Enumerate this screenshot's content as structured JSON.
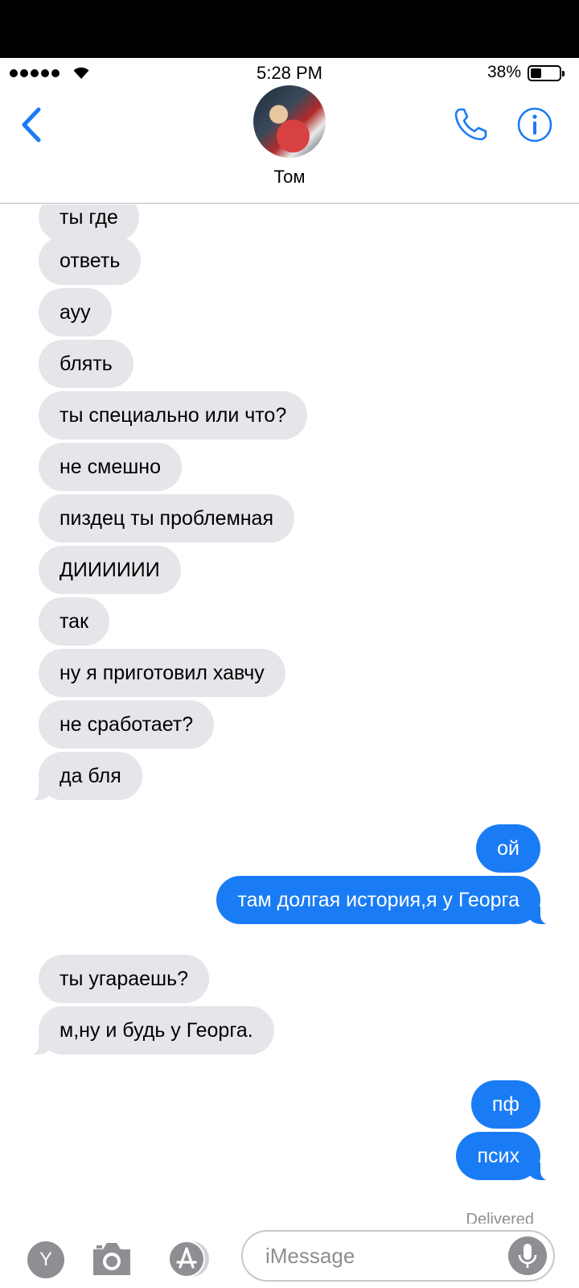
{
  "status_bar": {
    "time": "5:28 PM",
    "battery_percent": "38%",
    "battery_level": 0.38,
    "signal_bars": 5
  },
  "nav": {
    "contact_name": "Том",
    "back_icon": "chevron-left-icon",
    "phone_icon": "phone-icon",
    "info_icon": "info-icon",
    "accent_color": "#1a7cf5"
  },
  "messages": [
    {
      "side": "in",
      "text": "ты где"
    },
    {
      "side": "in",
      "text": "ответь"
    },
    {
      "side": "in",
      "text": "ауу"
    },
    {
      "side": "in",
      "text": "блять"
    },
    {
      "side": "in",
      "text": "ты специально или что?"
    },
    {
      "side": "in",
      "text": "не смешно"
    },
    {
      "side": "in",
      "text": "пиздец ты проблемная"
    },
    {
      "side": "in",
      "text": "ДИИИИИИ"
    },
    {
      "side": "in",
      "text": "так"
    },
    {
      "side": "in",
      "text": "ну я приготовил хавчу"
    },
    {
      "side": "in",
      "text": "не сработает?"
    },
    {
      "side": "in",
      "text": "да бля"
    },
    {
      "side": "out",
      "text": "ой"
    },
    {
      "side": "out",
      "text": "там долгая история,я у Георга"
    },
    {
      "side": "in",
      "text": "ты угараешь?"
    },
    {
      "side": "in",
      "text": "м,ну и будь у Георга."
    },
    {
      "side": "out",
      "text": "пф"
    },
    {
      "side": "out",
      "text": "псих"
    }
  ],
  "delivered_label": "Delivered",
  "input_bar": {
    "app_letter": "Y",
    "placeholder": "iMessage",
    "camera_icon": "camera-icon",
    "appstore_icon": "app-store-icon",
    "mic_icon": "microphone-icon"
  },
  "colors": {
    "incoming_bubble": "#e5e5ea",
    "outgoing_bubble": "#1a7cf5"
  }
}
